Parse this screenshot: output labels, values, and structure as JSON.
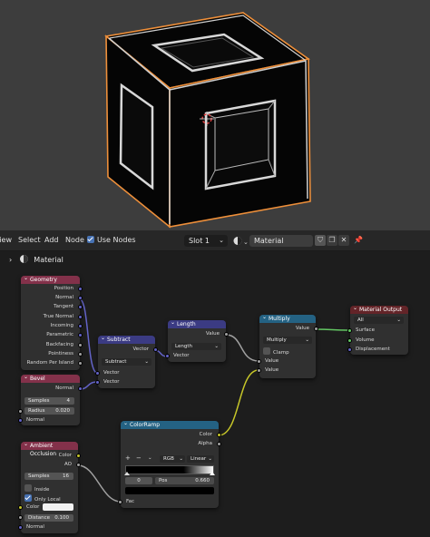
{
  "header": {
    "menu": [
      "View",
      "Select",
      "Add",
      "Node"
    ],
    "use_nodes_label": "Use Nodes",
    "slot": "Slot 1",
    "material_name": "Material"
  },
  "breadcrumb": {
    "label": "Material"
  },
  "nodes": {
    "geometry": {
      "title": "Geometry",
      "outputs": [
        "Position",
        "Normal",
        "Tangent",
        "True Normal",
        "Incoming",
        "Parametric",
        "Backfacing",
        "Pointiness",
        "Random Per Island"
      ]
    },
    "bevel": {
      "title": "Bevel",
      "output": "Normal",
      "samples_label": "Samples",
      "samples_value": "4",
      "radius_label": "Radius",
      "radius_value": "0.020",
      "input": "Normal"
    },
    "ao": {
      "title": "Ambient Occlusion",
      "outputs": [
        "Color",
        "AO"
      ],
      "samples_label": "Samples",
      "samples_value": "16",
      "inside_label": "Inside",
      "only_local_label": "Only Local",
      "color_label": "Color",
      "distance_label": "Distance",
      "distance_value": "0.100",
      "normal_label": "Normal"
    },
    "subtract": {
      "title": "Subtract",
      "output": "Vector",
      "operation": "Subtract",
      "inputs": [
        "Vector",
        "Vector"
      ]
    },
    "length": {
      "title": "Length",
      "output": "Value",
      "operation": "Length",
      "input": "Vector"
    },
    "multiply": {
      "title": "Multiply",
      "output": "Value",
      "operation": "Multiply",
      "clamp_label": "Clamp",
      "inputs": [
        "Value",
        "Value"
      ]
    },
    "colorramp": {
      "title": "ColorRamp",
      "outputs": [
        "Color",
        "Alpha"
      ],
      "plus": "+",
      "minus": "−",
      "dropdown_arrow": "⌄",
      "mode": "RGB",
      "interp": "Linear",
      "index": "0",
      "pos_label": "Pos",
      "pos_value": "0.660",
      "input": "Fac"
    },
    "output": {
      "title": "Material Output",
      "target": "All",
      "inputs": [
        "Surface",
        "Volume",
        "Displacement"
      ]
    }
  }
}
